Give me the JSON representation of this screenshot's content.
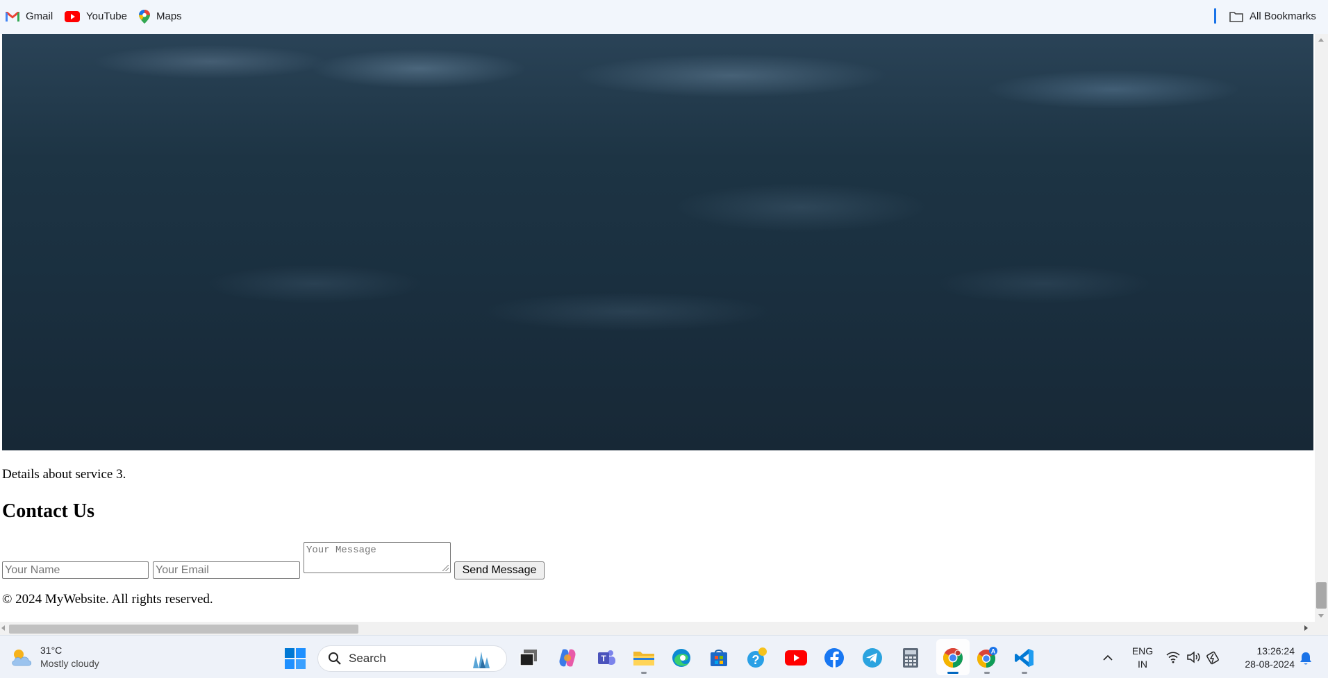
{
  "bookmarks": {
    "items": [
      {
        "label": "Gmail",
        "icon": "gmail-icon"
      },
      {
        "label": "YouTube",
        "icon": "youtube-icon"
      },
      {
        "label": "Maps",
        "icon": "maps-icon"
      }
    ],
    "all_bookmarks": "All Bookmarks"
  },
  "page": {
    "hero_image": "cloudy-night-sky-image",
    "service_details": "Details about service 3.",
    "contact_title": "Contact Us",
    "form": {
      "name_placeholder": "Your Name",
      "email_placeholder": "Your Email",
      "message_placeholder": "Your Message",
      "send_label": "Send Message"
    },
    "footer": "© 2024 MyWebsite. All rights reserved."
  },
  "taskbar": {
    "weather": {
      "temp": "31°C",
      "condition": "Mostly cloudy"
    },
    "search_placeholder": "Search",
    "apps": [
      "task-view",
      "copilot",
      "teams",
      "file-explorer",
      "edge",
      "store",
      "help",
      "youtube",
      "facebook",
      "telegram",
      "calculator",
      "chrome",
      "chrome-profile",
      "vscode"
    ],
    "tray": {
      "language": "ENG",
      "region": "IN",
      "time": "13:26:24",
      "date": "28-08-2024"
    }
  },
  "colors": {
    "accent": "#0067c0",
    "bookmark_bar": "#f2f6fc",
    "taskbar": "#eef2f9"
  }
}
